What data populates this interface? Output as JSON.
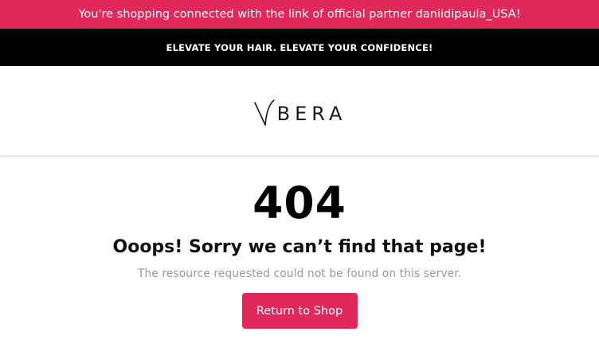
{
  "partner_bar": {
    "text": "You're shopping connected with the link of official partner daniidipaula_USA!",
    "background": "#e0285a"
  },
  "promo_bar": {
    "text": "ELEVATE YOUR HAIR. ELEVATE YOUR CONFIDENCE!"
  },
  "header": {
    "logo_text": "BERA",
    "logo_mark_icon": "ybera-y-mark"
  },
  "error": {
    "code": "404",
    "title": "Ooops! Sorry we can’t find that page!",
    "description": "The resource requested could not be found on this server.",
    "button_label": "Return to Shop",
    "accent": "#e0285a"
  }
}
